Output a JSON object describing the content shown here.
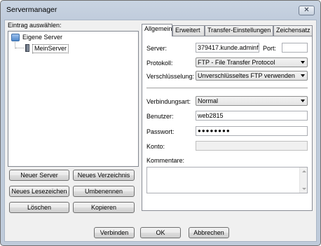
{
  "window": {
    "title": "Servermanager",
    "close_glyph": "✕"
  },
  "left": {
    "select_label": "Eintrag auswählen:",
    "tree": {
      "root_label": "Eigene Server",
      "child_label": "MeinServer"
    },
    "buttons": {
      "new_server": "Neuer Server",
      "new_folder": "Neues Verzeichnis",
      "new_bookmark": "Neues Lesezeichen",
      "rename": "Umbenennen",
      "delete": "Löschen",
      "copy": "Kopieren"
    }
  },
  "tabs": [
    "Allgemein",
    "Erweitert",
    "Transfer-Einstellungen",
    "Zeichensatz"
  ],
  "general": {
    "server_label": "Server:",
    "server_value": "379417.kunde.adminfl",
    "port_label": "Port:",
    "port_value": "",
    "protocol_label": "Protokoll:",
    "protocol_value": "FTP - File Transfer Protocol",
    "encryption_label": "Verschlüsselung:",
    "encryption_value": "Unverschlüsseltes FTP verwenden",
    "logon_label": "Verbindungsart:",
    "logon_value": "Normal",
    "user_label": "Benutzer:",
    "user_value": "web2815",
    "password_label": "Passwort:",
    "password_value": "●●●●●●●●",
    "account_label": "Konto:",
    "account_value": "",
    "comments_label": "Kommentare:",
    "comments_value": ""
  },
  "footer": {
    "connect": "Verbinden",
    "ok": "OK",
    "cancel": "Abbrechen"
  }
}
